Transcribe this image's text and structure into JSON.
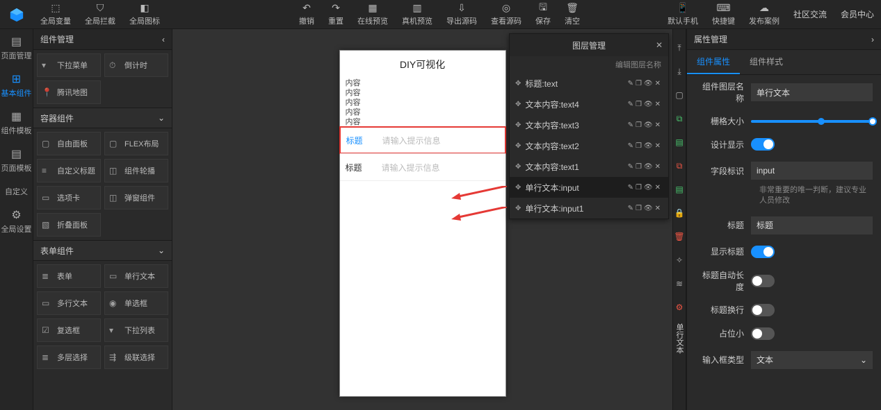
{
  "topbar": {
    "left_tools": [
      {
        "icon": "⬚",
        "label": "全局变量"
      },
      {
        "icon": "⛉",
        "label": "全局拦截"
      },
      {
        "icon": "◧",
        "label": "全局图标"
      }
    ],
    "center_tools": [
      {
        "icon": "↶",
        "label": "撤销"
      },
      {
        "icon": "↷",
        "label": "重置"
      },
      {
        "icon": "▦",
        "label": "在线预览"
      },
      {
        "icon": "▥",
        "label": "真机预览"
      },
      {
        "icon": "⇩",
        "label": "导出源码"
      },
      {
        "icon": "◎",
        "label": "查看源码"
      },
      {
        "icon": "🖫",
        "label": "保存"
      },
      {
        "icon": "🗑",
        "label": "清空"
      }
    ],
    "right_tools": [
      {
        "icon": "📱",
        "label": "默认手机"
      },
      {
        "icon": "⌨",
        "label": "快捷键"
      },
      {
        "icon": "☁",
        "label": "发布案例"
      }
    ],
    "right_links": [
      "社区交流",
      "会员中心"
    ]
  },
  "left_rail": [
    {
      "icon": "▤",
      "label": "页面管理",
      "active": false
    },
    {
      "icon": "⊞",
      "label": "基本组件",
      "active": true
    },
    {
      "icon": "▦",
      "label": "组件模板",
      "active": false
    },
    {
      "icon": "▤",
      "label": "页面模板",
      "active": false
    },
    {
      "icon": "</>",
      "label": "自定义",
      "active": false
    },
    {
      "icon": "⚙",
      "label": "全局设置",
      "active": false
    }
  ],
  "left_panel": {
    "title": "组件管理",
    "group0_items": [
      {
        "icon": "▾",
        "label": "下拉菜单"
      },
      {
        "icon": "⏱",
        "label": "倒计时"
      },
      {
        "icon": "📍",
        "label": "腾讯地图"
      }
    ],
    "groups": [
      {
        "title": "容器组件",
        "items": [
          {
            "icon": "▢",
            "label": "自由面板"
          },
          {
            "icon": "▢",
            "label": "FLEX布局"
          },
          {
            "icon": "≡",
            "label": "自定义标题"
          },
          {
            "icon": "◫",
            "label": "组件轮播"
          },
          {
            "icon": "▭",
            "label": "选项卡"
          },
          {
            "icon": "◫",
            "label": "弹窗组件"
          },
          {
            "icon": "▧",
            "label": "折叠面板"
          }
        ]
      },
      {
        "title": "表单组件",
        "items": [
          {
            "icon": "≣",
            "label": "表单"
          },
          {
            "icon": "▭",
            "label": "单行文本"
          },
          {
            "icon": "▭",
            "label": "多行文本"
          },
          {
            "icon": "◉",
            "label": "单选框"
          },
          {
            "icon": "☑",
            "label": "复选框"
          },
          {
            "icon": "▾",
            "label": "下拉列表"
          },
          {
            "icon": "≣",
            "label": "多层选择"
          },
          {
            "icon": "⇶",
            "label": "级联选择"
          }
        ]
      }
    ]
  },
  "canvas": {
    "title": "DIY可视化",
    "text_lines": [
      "内容",
      "内容",
      "内容",
      "内容",
      "内容"
    ],
    "inputs": [
      {
        "label": "标题",
        "placeholder": "请输入提示信息",
        "selected": true
      },
      {
        "label": "标题",
        "placeholder": "请输入提示信息",
        "selected": false
      }
    ]
  },
  "layer_panel": {
    "title": "图层管理",
    "subtitle": "编辑图层名称",
    "items": [
      {
        "name": "标题:text",
        "selected": false
      },
      {
        "name": "文本内容:text4",
        "selected": false
      },
      {
        "name": "文本内容:text3",
        "selected": false
      },
      {
        "name": "文本内容:text2",
        "selected": false
      },
      {
        "name": "文本内容:text1",
        "selected": false
      },
      {
        "name": "单行文本:input",
        "selected": true
      },
      {
        "name": "单行文本:input1",
        "selected": false
      }
    ]
  },
  "right_rail": [
    {
      "glyph": "⤒",
      "cls": ""
    },
    {
      "glyph": "⤓",
      "cls": ""
    },
    {
      "glyph": "▢",
      "cls": ""
    },
    {
      "glyph": "⧉",
      "cls": "green"
    },
    {
      "glyph": "▤",
      "cls": "green"
    },
    {
      "glyph": "⧉",
      "cls": "red"
    },
    {
      "glyph": "▤",
      "cls": "green"
    },
    {
      "glyph": "🔒",
      "cls": ""
    },
    {
      "glyph": "🗑",
      "cls": "red"
    },
    {
      "glyph": "✧",
      "cls": ""
    },
    {
      "glyph": "≋",
      "cls": ""
    },
    {
      "glyph": "⚙",
      "cls": "red"
    }
  ],
  "right_rail_text": "单行文本",
  "right_panel": {
    "title": "属性管理",
    "tabs": [
      "组件属性",
      "组件样式"
    ],
    "active_tab": 0,
    "props": {
      "name_label": "组件图层名称",
      "name_value": "单行文本",
      "grid_label": "栅格大小",
      "design_label": "设计显示",
      "design_on": true,
      "field_label": "字段标识",
      "field_value": "input",
      "field_hint": "非常重要的唯一判断，建议专业人员修改",
      "title_label": "标题",
      "title_value": "标题",
      "showtitle_label": "显示标题",
      "showtitle_on": true,
      "autolen_label": "标题自动长度",
      "autolen_on": false,
      "wrap_label": "标题换行",
      "wrap_on": false,
      "small_label": "占位小",
      "small_on": false,
      "type_label": "输入框类型",
      "type_value": "文本"
    }
  }
}
